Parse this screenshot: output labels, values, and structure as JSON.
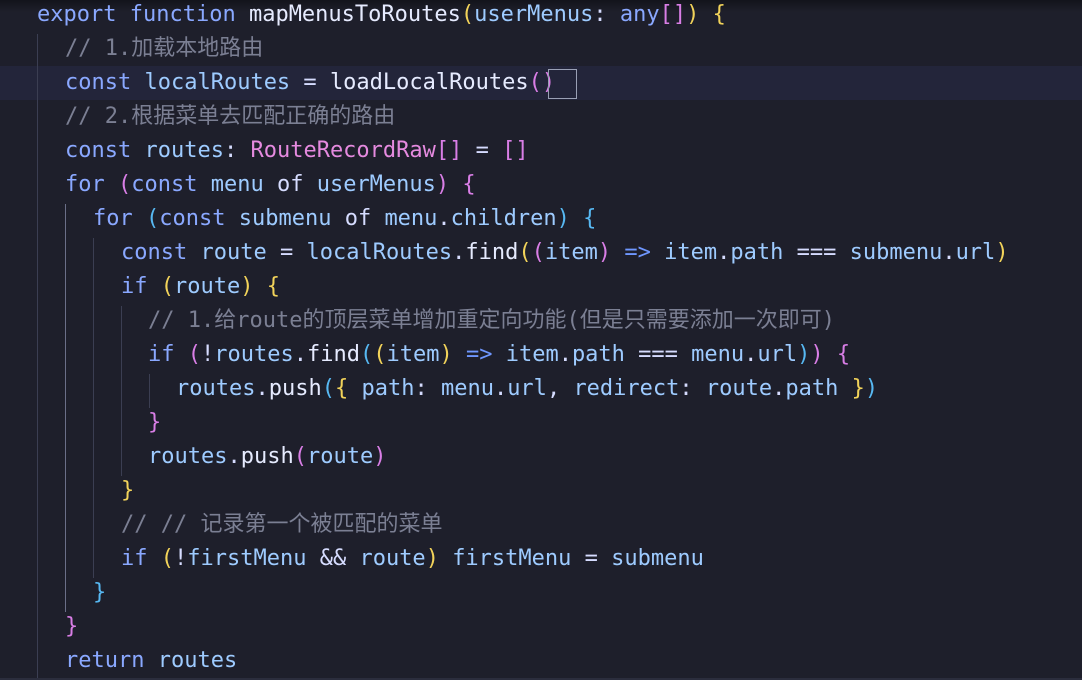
{
  "editor": {
    "lines": [
      {
        "tokens": [
          {
            "text": "export",
            "c": "kw"
          },
          {
            "text": " ",
            "c": "op"
          },
          {
            "text": "function",
            "c": "kw"
          },
          {
            "text": " ",
            "c": "op"
          },
          {
            "text": "mapMenusToRoutes",
            "c": "fnc"
          },
          {
            "text": "(",
            "c": "b1"
          },
          {
            "text": "userMenus",
            "c": "var"
          },
          {
            "text": ": ",
            "c": "op"
          },
          {
            "text": "any",
            "c": "kw"
          },
          {
            "text": "[]",
            "c": "b2"
          },
          {
            "text": ")",
            "c": "b1"
          },
          {
            "text": " ",
            "c": "op"
          },
          {
            "text": "{",
            "c": "b1"
          }
        ]
      },
      {
        "tokens": [
          {
            "text": "// 1.加载本地路由",
            "c": "cm"
          }
        ]
      },
      {
        "tokens": [
          {
            "text": "const",
            "c": "kw"
          },
          {
            "text": " ",
            "c": "op"
          },
          {
            "text": "localRoutes",
            "c": "var"
          },
          {
            "text": " = ",
            "c": "op"
          },
          {
            "text": "loadLocalRoutes",
            "c": "fnc"
          },
          {
            "text": "()",
            "c": "b2"
          }
        ]
      },
      {
        "tokens": [
          {
            "text": "// 2.根据菜单去匹配正确的路由",
            "c": "cm"
          }
        ]
      },
      {
        "tokens": [
          {
            "text": "const",
            "c": "kw"
          },
          {
            "text": " ",
            "c": "op"
          },
          {
            "text": "routes",
            "c": "var"
          },
          {
            "text": ": ",
            "c": "op"
          },
          {
            "text": "RouteRecordRaw",
            "c": "ty"
          },
          {
            "text": "[]",
            "c": "b2"
          },
          {
            "text": " = ",
            "c": "op"
          },
          {
            "text": "[]",
            "c": "b2"
          }
        ]
      },
      {
        "tokens": [
          {
            "text": "for",
            "c": "kw2"
          },
          {
            "text": " ",
            "c": "op"
          },
          {
            "text": "(",
            "c": "b2"
          },
          {
            "text": "const",
            "c": "kw"
          },
          {
            "text": " ",
            "c": "op"
          },
          {
            "text": "menu",
            "c": "var"
          },
          {
            "text": " of ",
            "c": "op"
          },
          {
            "text": "userMenus",
            "c": "var"
          },
          {
            "text": ")",
            "c": "b2"
          },
          {
            "text": " ",
            "c": "op"
          },
          {
            "text": "{",
            "c": "b2"
          }
        ]
      },
      {
        "tokens": [
          {
            "text": "for",
            "c": "kw2"
          },
          {
            "text": " ",
            "c": "op"
          },
          {
            "text": "(",
            "c": "b3"
          },
          {
            "text": "const",
            "c": "kw"
          },
          {
            "text": " ",
            "c": "op"
          },
          {
            "text": "submenu",
            "c": "var"
          },
          {
            "text": " of ",
            "c": "op"
          },
          {
            "text": "menu",
            "c": "var"
          },
          {
            "text": ".",
            "c": "op"
          },
          {
            "text": "children",
            "c": "prop"
          },
          {
            "text": ")",
            "c": "b3"
          },
          {
            "text": " ",
            "c": "op"
          },
          {
            "text": "{",
            "c": "b3"
          }
        ]
      },
      {
        "tokens": [
          {
            "text": "const",
            "c": "kw"
          },
          {
            "text": " ",
            "c": "op"
          },
          {
            "text": "route",
            "c": "var"
          },
          {
            "text": " = ",
            "c": "op"
          },
          {
            "text": "localRoutes",
            "c": "var"
          },
          {
            "text": ".",
            "c": "op"
          },
          {
            "text": "find",
            "c": "fnc"
          },
          {
            "text": "(",
            "c": "b1"
          },
          {
            "text": "(",
            "c": "b2"
          },
          {
            "text": "item",
            "c": "var"
          },
          {
            "text": ")",
            "c": "b2"
          },
          {
            "text": " ",
            "c": "op"
          },
          {
            "text": "=>",
            "c": "arr"
          },
          {
            "text": " ",
            "c": "op"
          },
          {
            "text": "item",
            "c": "var"
          },
          {
            "text": ".",
            "c": "op"
          },
          {
            "text": "path",
            "c": "prop"
          },
          {
            "text": " === ",
            "c": "op"
          },
          {
            "text": "submenu",
            "c": "var"
          },
          {
            "text": ".",
            "c": "op"
          },
          {
            "text": "url",
            "c": "prop"
          },
          {
            "text": ")",
            "c": "b1"
          }
        ]
      },
      {
        "tokens": [
          {
            "text": "if",
            "c": "kw2"
          },
          {
            "text": " ",
            "c": "op"
          },
          {
            "text": "(",
            "c": "b1"
          },
          {
            "text": "route",
            "c": "var"
          },
          {
            "text": ")",
            "c": "b1"
          },
          {
            "text": " ",
            "c": "op"
          },
          {
            "text": "{",
            "c": "b1"
          }
        ]
      },
      {
        "tokens": [
          {
            "text": "// 1.给route的顶层菜单增加重定向功能(但是只需要添加一次即可)",
            "c": "cm"
          }
        ]
      },
      {
        "tokens": [
          {
            "text": "if",
            "c": "kw2"
          },
          {
            "text": " ",
            "c": "op"
          },
          {
            "text": "(",
            "c": "b2"
          },
          {
            "text": "!",
            "c": "op"
          },
          {
            "text": "routes",
            "c": "var"
          },
          {
            "text": ".",
            "c": "op"
          },
          {
            "text": "find",
            "c": "fnc"
          },
          {
            "text": "(",
            "c": "b3"
          },
          {
            "text": "(",
            "c": "b1"
          },
          {
            "text": "item",
            "c": "var"
          },
          {
            "text": ")",
            "c": "b1"
          },
          {
            "text": " ",
            "c": "op"
          },
          {
            "text": "=>",
            "c": "arr"
          },
          {
            "text": " ",
            "c": "op"
          },
          {
            "text": "item",
            "c": "var"
          },
          {
            "text": ".",
            "c": "op"
          },
          {
            "text": "path",
            "c": "prop"
          },
          {
            "text": " === ",
            "c": "op"
          },
          {
            "text": "menu",
            "c": "var"
          },
          {
            "text": ".",
            "c": "op"
          },
          {
            "text": "url",
            "c": "prop"
          },
          {
            "text": ")",
            "c": "b3"
          },
          {
            "text": ")",
            "c": "b2"
          },
          {
            "text": " ",
            "c": "op"
          },
          {
            "text": "{",
            "c": "b2"
          }
        ]
      },
      {
        "tokens": [
          {
            "text": "routes",
            "c": "var"
          },
          {
            "text": ".",
            "c": "op"
          },
          {
            "text": "push",
            "c": "fnc"
          },
          {
            "text": "(",
            "c": "b3"
          },
          {
            "text": "{",
            "c": "b1"
          },
          {
            "text": " ",
            "c": "op"
          },
          {
            "text": "path",
            "c": "prop"
          },
          {
            "text": ": ",
            "c": "op"
          },
          {
            "text": "menu",
            "c": "var"
          },
          {
            "text": ".",
            "c": "op"
          },
          {
            "text": "url",
            "c": "prop"
          },
          {
            "text": ", ",
            "c": "op"
          },
          {
            "text": "redirect",
            "c": "prop"
          },
          {
            "text": ": ",
            "c": "op"
          },
          {
            "text": "route",
            "c": "var"
          },
          {
            "text": ".",
            "c": "op"
          },
          {
            "text": "path",
            "c": "prop"
          },
          {
            "text": " ",
            "c": "op"
          },
          {
            "text": "}",
            "c": "b1"
          },
          {
            "text": ")",
            "c": "b3"
          }
        ]
      },
      {
        "tokens": [
          {
            "text": "}",
            "c": "b2"
          }
        ]
      },
      {
        "tokens": [
          {
            "text": "routes",
            "c": "var"
          },
          {
            "text": ".",
            "c": "op"
          },
          {
            "text": "push",
            "c": "fnc"
          },
          {
            "text": "(",
            "c": "b2"
          },
          {
            "text": "route",
            "c": "var"
          },
          {
            "text": ")",
            "c": "b2"
          }
        ]
      },
      {
        "tokens": [
          {
            "text": "}",
            "c": "b1"
          }
        ]
      },
      {
        "tokens": [
          {
            "text": "// // 记录第一个被匹配的菜单",
            "c": "cm"
          }
        ]
      },
      {
        "tokens": [
          {
            "text": "if",
            "c": "kw2"
          },
          {
            "text": " ",
            "c": "op"
          },
          {
            "text": "(",
            "c": "b1"
          },
          {
            "text": "!",
            "c": "op"
          },
          {
            "text": "firstMenu",
            "c": "var"
          },
          {
            "text": " && ",
            "c": "op"
          },
          {
            "text": "route",
            "c": "var"
          },
          {
            "text": ")",
            "c": "b1"
          },
          {
            "text": " ",
            "c": "op"
          },
          {
            "text": "firstMenu",
            "c": "var"
          },
          {
            "text": " = ",
            "c": "op"
          },
          {
            "text": "submenu",
            "c": "var"
          }
        ]
      },
      {
        "tokens": [
          {
            "text": "}",
            "c": "b3"
          }
        ]
      },
      {
        "tokens": [
          {
            "text": "}",
            "c": "b2"
          }
        ]
      },
      {
        "tokens": [
          {
            "text": "return",
            "c": "kw2"
          },
          {
            "text": " ",
            "c": "op"
          },
          {
            "text": "routes",
            "c": "var"
          }
        ]
      }
    ]
  }
}
